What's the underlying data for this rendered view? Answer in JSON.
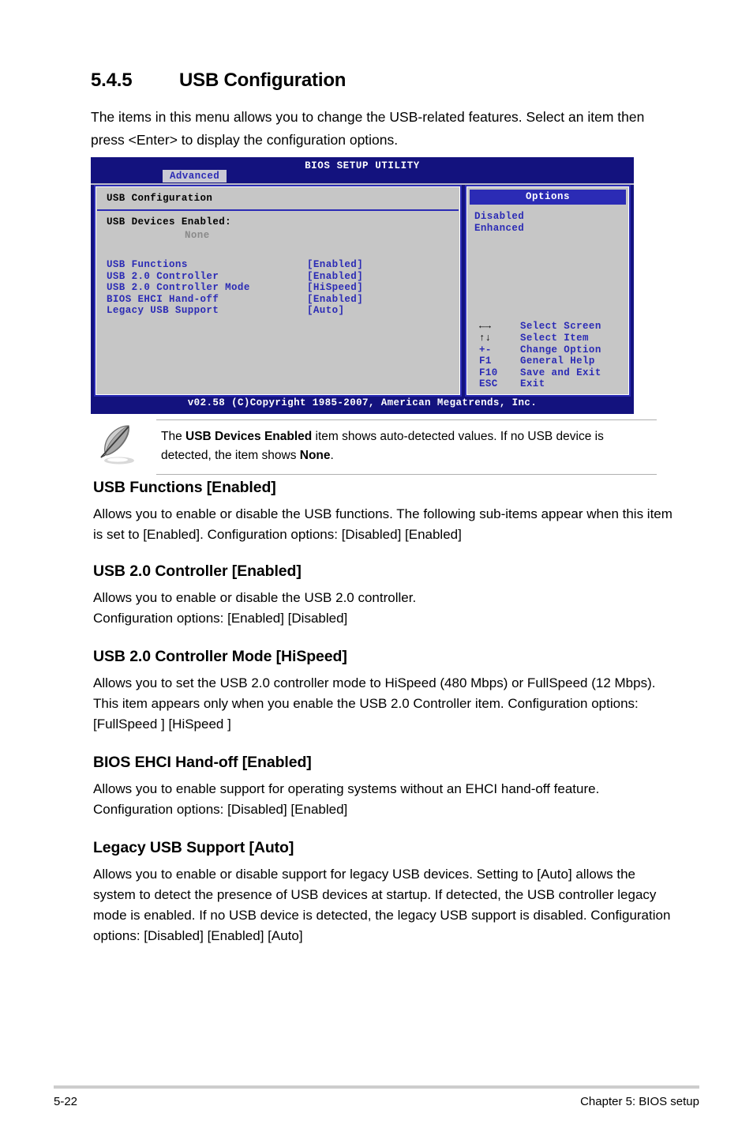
{
  "section": {
    "number": "5.4.5",
    "title": "USB Configuration",
    "intro": "The items in this menu allows you to change the USB-related features. Select an item then press <Enter> to display the configuration options."
  },
  "bios": {
    "utility_title": "BIOS SETUP UTILITY",
    "active_tab": "Advanced",
    "config_title": "USB Configuration",
    "devices_label": "USB Devices Enabled:",
    "devices_value": "None",
    "items": [
      {
        "name": "USB Functions",
        "value": "[Enabled]"
      },
      {
        "name": "USB 2.0 Controller",
        "value": "[Enabled]"
      },
      {
        "name": "USB 2.0 Controller Mode",
        "value": "[HiSpeed]"
      },
      {
        "name": "BIOS EHCI Hand-off",
        "value": "[Enabled]"
      },
      {
        "name": "Legacy USB Support",
        "value": "[Auto]"
      }
    ],
    "options_header": "Options",
    "options": [
      "Disabled",
      "Enhanced"
    ],
    "legend": [
      {
        "key": "←→",
        "desc": "Select Screen",
        "arrows": true
      },
      {
        "key": "↑↓",
        "desc": "Select Item",
        "arrows": true
      },
      {
        "key": "+-",
        "desc": "Change Option",
        "arrows": false
      },
      {
        "key": "F1",
        "desc": "General Help",
        "arrows": false
      },
      {
        "key": "F10",
        "desc": "Save and Exit",
        "arrows": false
      },
      {
        "key": "ESC",
        "desc": "Exit",
        "arrows": false
      }
    ],
    "copyright": "v02.58 (C)Copyright 1985-2007, American Megatrends, Inc."
  },
  "note": {
    "text_before": "The ",
    "bold_1": "USB Devices Enabled",
    "text_middle": " item shows auto-detected values. If no USB device is detected, the item shows ",
    "bold_2": "None",
    "text_after": "."
  },
  "subsections": [
    {
      "heading": "USB Functions [Enabled]",
      "body": "Allows you to enable or disable the USB functions. The following sub-items appear when this item is set to [Enabled]. Configuration options: [Disabled] [Enabled]"
    },
    {
      "heading": "USB 2.0 Controller [Enabled]",
      "body": "Allows you to enable or disable the USB 2.0 controller.\nConfiguration options: [Enabled] [Disabled]"
    },
    {
      "heading": "USB 2.0 Controller Mode [HiSpeed]",
      "body": "Allows you to set the USB 2.0 controller mode to HiSpeed (480 Mbps) or FullSpeed (12 Mbps). This item appears only when you enable the USB 2.0 Controller item. Configuration options: [FullSpeed ] [HiSpeed ]"
    },
    {
      "heading": "BIOS EHCI Hand-off [Enabled]",
      "body": "Allows you to enable support for operating systems without an EHCI hand-off feature. Configuration options: [Disabled] [Enabled]"
    },
    {
      "heading": "Legacy USB Support [Auto]",
      "body": "Allows you to enable or disable support for legacy USB devices. Setting to [Auto] allows the system to detect the presence of USB devices at startup. If detected, the USB controller legacy mode is enabled. If no USB device is detected, the legacy USB support is disabled. Configuration options: [Disabled] [Enabled] [Auto]"
    }
  ],
  "footer": {
    "page_number": "5-22",
    "chapter": "Chapter 5: BIOS setup"
  },
  "colors": {
    "bios_background": "#13127e",
    "panel_background": "#c6c6c6",
    "bios_accent": "#2b2bb5",
    "dim_text": "#8a8a8a"
  }
}
